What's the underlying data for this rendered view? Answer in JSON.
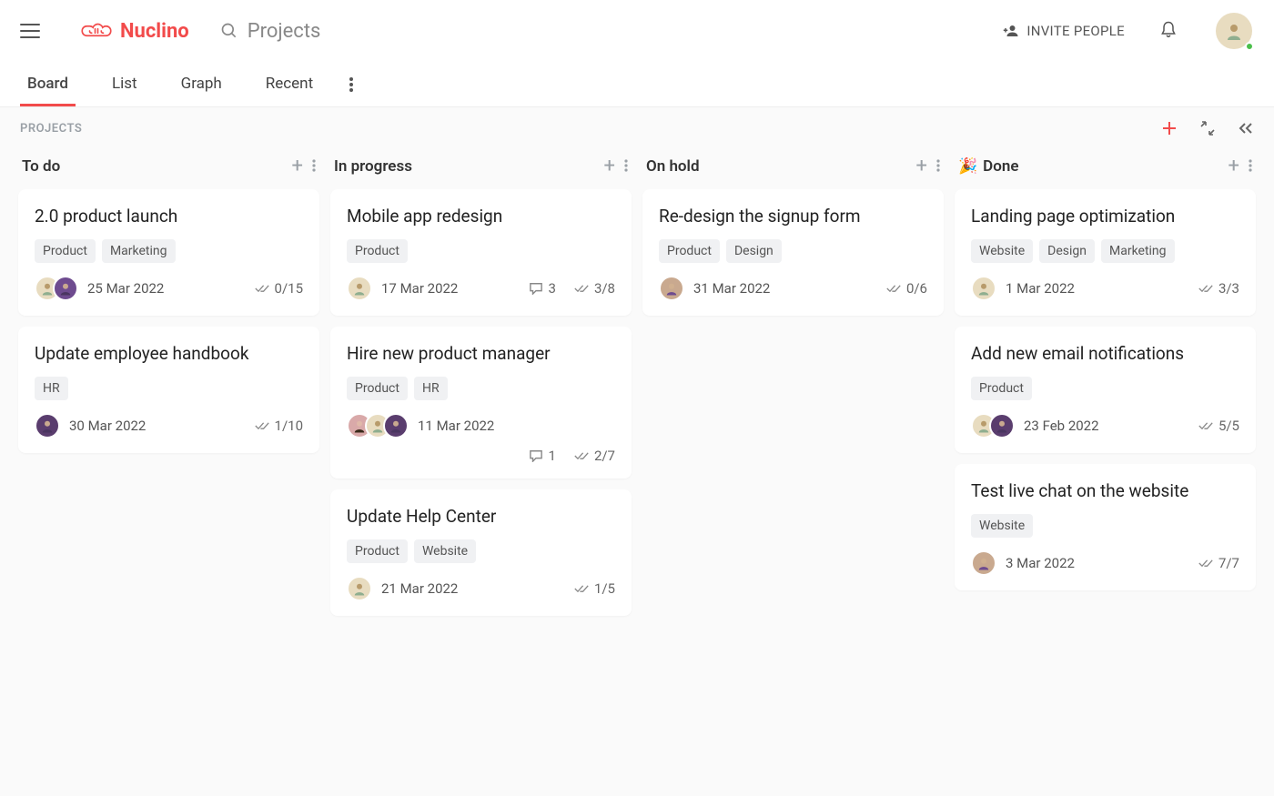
{
  "app": {
    "name": "Nuclino",
    "search_placeholder": "Projects",
    "invite_label": "INVITE PEOPLE"
  },
  "tabs": [
    {
      "label": "Board",
      "active": true
    },
    {
      "label": "List",
      "active": false
    },
    {
      "label": "Graph",
      "active": false
    },
    {
      "label": "Recent",
      "active": false
    }
  ],
  "breadcrumb": "PROJECTS",
  "columns": [
    {
      "title": "To do",
      "emoji": "",
      "cards": [
        {
          "title": "2.0 product launch",
          "tags": [
            "Product",
            "Marketing"
          ],
          "avatars": [
            "av1",
            "av2"
          ],
          "date": "25 Mar 2022",
          "comments": null,
          "checklist": "0/15",
          "secondRow": false
        },
        {
          "title": "Update employee handbook",
          "tags": [
            "HR"
          ],
          "avatars": [
            "av4"
          ],
          "date": "30 Mar 2022",
          "comments": null,
          "checklist": "1/10",
          "secondRow": false
        }
      ]
    },
    {
      "title": "In progress",
      "emoji": "",
      "cards": [
        {
          "title": "Mobile app redesign",
          "tags": [
            "Product"
          ],
          "avatars": [
            "av1"
          ],
          "date": "17 Mar 2022",
          "comments": "3",
          "checklist": "3/8",
          "secondRow": false
        },
        {
          "title": "Hire new product manager",
          "tags": [
            "Product",
            "HR"
          ],
          "avatars": [
            "av3",
            "av1",
            "av4"
          ],
          "date": "11 Mar 2022",
          "comments": "1",
          "checklist": "2/7",
          "secondRow": true
        },
        {
          "title": "Update Help Center",
          "tags": [
            "Product",
            "Website"
          ],
          "avatars": [
            "av1"
          ],
          "date": "21 Mar 2022",
          "comments": null,
          "checklist": "1/5",
          "secondRow": false
        }
      ]
    },
    {
      "title": "On hold",
      "emoji": "",
      "cards": [
        {
          "title": "Re-design the signup form",
          "tags": [
            "Product",
            "Design"
          ],
          "avatars": [
            "av5"
          ],
          "date": "31 Mar 2022",
          "comments": null,
          "checklist": "0/6",
          "secondRow": false
        }
      ]
    },
    {
      "title": "Done",
      "emoji": "🎉",
      "cards": [
        {
          "title": "Landing page optimization",
          "tags": [
            "Website",
            "Design",
            "Marketing"
          ],
          "avatars": [
            "av1"
          ],
          "date": "1 Mar 2022",
          "comments": null,
          "checklist": "3/3",
          "secondRow": false
        },
        {
          "title": "Add new email notifications",
          "tags": [
            "Product"
          ],
          "avatars": [
            "av1",
            "av4"
          ],
          "date": "23 Feb 2022",
          "comments": null,
          "checklist": "5/5",
          "secondRow": false
        },
        {
          "title": "Test live chat on the website",
          "tags": [
            "Website"
          ],
          "avatars": [
            "av5"
          ],
          "date": "3 Mar 2022",
          "comments": null,
          "checklist": "7/7",
          "secondRow": false
        }
      ]
    }
  ]
}
